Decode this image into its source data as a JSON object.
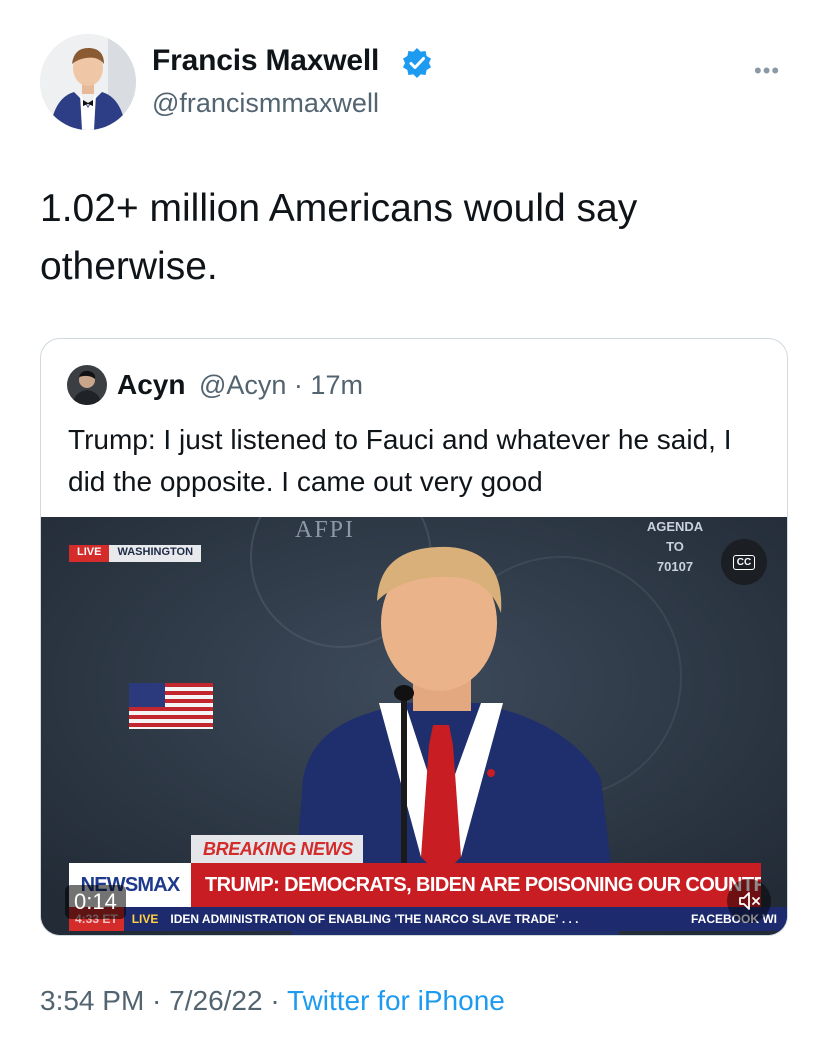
{
  "author": {
    "display_name": "Francis Maxwell",
    "handle": "@francismmaxwell",
    "verified_icon": "verified-badge-icon",
    "avatar_icon": "profile-photo"
  },
  "more_menu": {
    "label": "•••",
    "icon": "more-horizontal-icon"
  },
  "tweet": {
    "text": "1.02+ million Americans would say otherwise."
  },
  "quoted": {
    "display_name": "Acyn",
    "handle_time": "@Acyn · 17m",
    "text": "Trump: I just listened to Fauci and whatever he said, I did the opposite. I came out very good",
    "video": {
      "cc_label": "CC",
      "afpi_text": "AFPI",
      "agenda_text": [
        "AGENDA",
        "TO",
        "70107"
      ],
      "live_label": "LIVE",
      "location_label": "WASHINGTON",
      "breaking_label": "BREAKING NEWS",
      "network": "NEWSMAX",
      "headline": "TRUMP: DEMOCRATS, BIDEN ARE POISONING OUR COUNTRY",
      "ticker_time": "4:33 ET",
      "ticker_live": "LIVE",
      "ticker_text": "IDEN ADMINISTRATION OF ENABLING 'THE NARCO SLAVE TRADE' . . .",
      "ticker_social": "FACEBOOK WI",
      "elapsed": "0:14",
      "mute_icon": "speaker-muted-icon"
    }
  },
  "footer": {
    "time_date": "3:54 PM · 7/26/22 · ",
    "source": "Twitter for iPhone"
  },
  "colors": {
    "accent": "#1d9bf0",
    "secondary_text": "#536471",
    "news_red": "#c81d22",
    "news_navy": "#1d2a6e"
  }
}
